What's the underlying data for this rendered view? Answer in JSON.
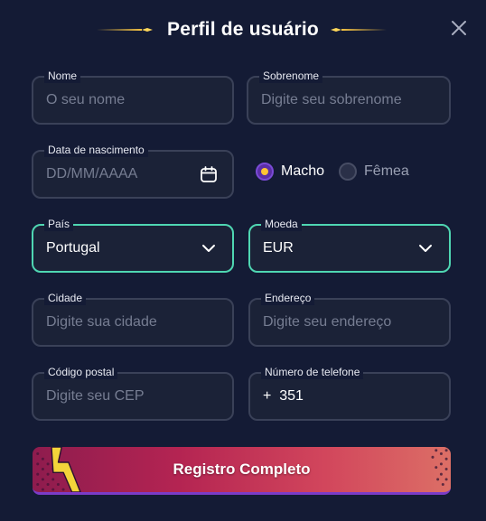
{
  "header": {
    "title": "Perfil de usuário"
  },
  "form": {
    "nome": {
      "label": "Nome",
      "placeholder": "O seu nome"
    },
    "sobrenome": {
      "label": "Sobrenome",
      "placeholder": "Digite seu sobrenome"
    },
    "nascimento": {
      "label": "Data de nascimento",
      "placeholder": "DD/MM/AAAA"
    },
    "gender": {
      "options": [
        {
          "label": "Macho",
          "selected": true
        },
        {
          "label": "Fêmea",
          "selected": false
        }
      ]
    },
    "pais": {
      "label": "País",
      "value": "Portugal"
    },
    "moeda": {
      "label": "Moeda",
      "value": "EUR"
    },
    "cidade": {
      "label": "Cidade",
      "placeholder": "Digite sua cidade"
    },
    "endereco": {
      "label": "Endereço",
      "placeholder": "Digite seu endereço"
    },
    "cep": {
      "label": "Código postal",
      "placeholder": "Digite seu CEP"
    },
    "telefone": {
      "label": "Número de telefone",
      "value": "+  351"
    }
  },
  "submit": {
    "label": "Registro Completo"
  },
  "icons": {
    "close": "close-icon",
    "calendar": "calendar-icon",
    "chevron": "chevron-down-icon",
    "sparkle": "sparkle-icon"
  },
  "colors": {
    "background": "#141b35",
    "field_border": "#3a4158",
    "active_border": "#4fd6b2",
    "radio_selected": "#ffc533",
    "accent_gold": "#f6c343",
    "button_start": "#8e1c4e",
    "button_end": "#dc6f66"
  }
}
